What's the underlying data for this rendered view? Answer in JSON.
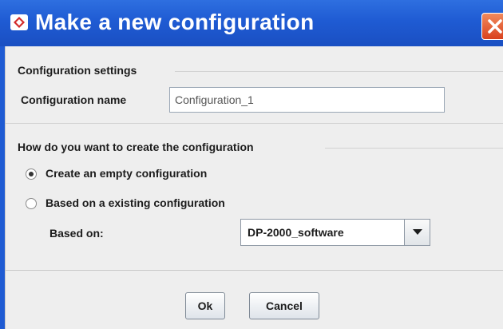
{
  "window": {
    "title": "Make a new configuration",
    "title_icon": "app-icon",
    "close_icon": "close-icon",
    "accent_color": "#1f5bd3",
    "close_color": "#d9411e"
  },
  "settings_group": {
    "heading": "Configuration settings",
    "name_label": "Configuration name",
    "name_value": "Configuration_1"
  },
  "creation_group": {
    "heading": "How do you want to create the configuration",
    "option_empty": "Create an empty configuration",
    "option_empty_selected": true,
    "option_existing": "Based on a existing configuration",
    "option_existing_selected": false,
    "based_on_label": "Based on:",
    "based_on_value": "DP-2000_software",
    "dropdown_icon": "chevron-down-icon"
  },
  "buttons": {
    "ok": "Ok",
    "cancel": "Cancel"
  }
}
